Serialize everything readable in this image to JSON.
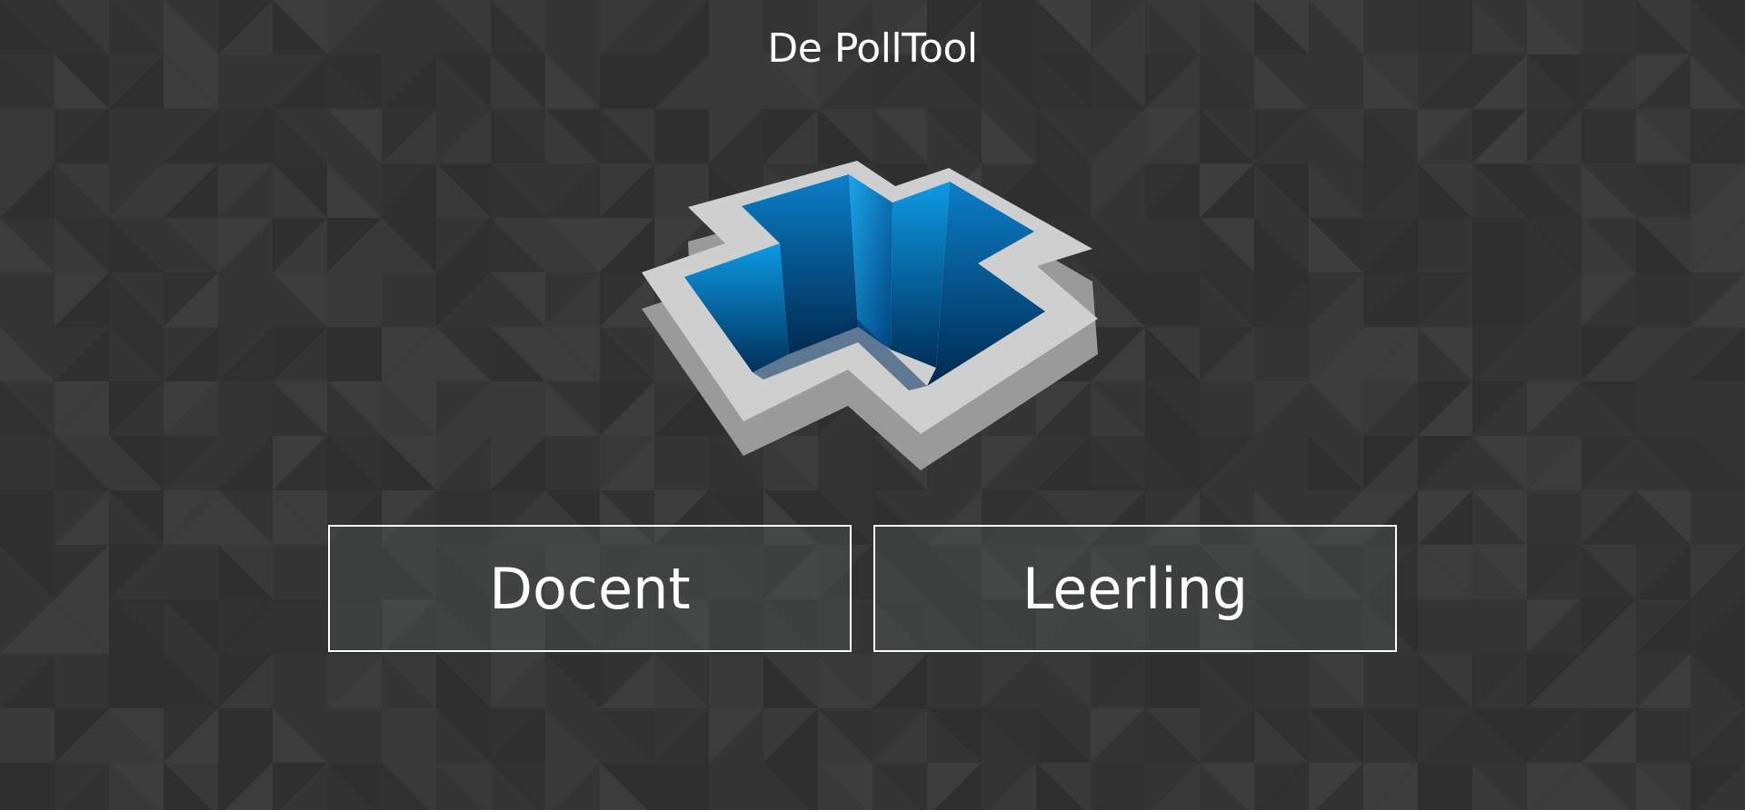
{
  "page": {
    "title": "De PollTool"
  },
  "logo": {
    "icon": "polltool-logo-icon"
  },
  "roles": {
    "teacher_label": "Docent",
    "student_label": "Leerling"
  },
  "colors": {
    "background": "#333333",
    "logo_blue": "#0a8bd6",
    "logo_dark_blue": "#003a66",
    "logo_frame": "#cfcfcf",
    "logo_shadow": "#9a9a9a",
    "button_border": "#ffffff"
  }
}
